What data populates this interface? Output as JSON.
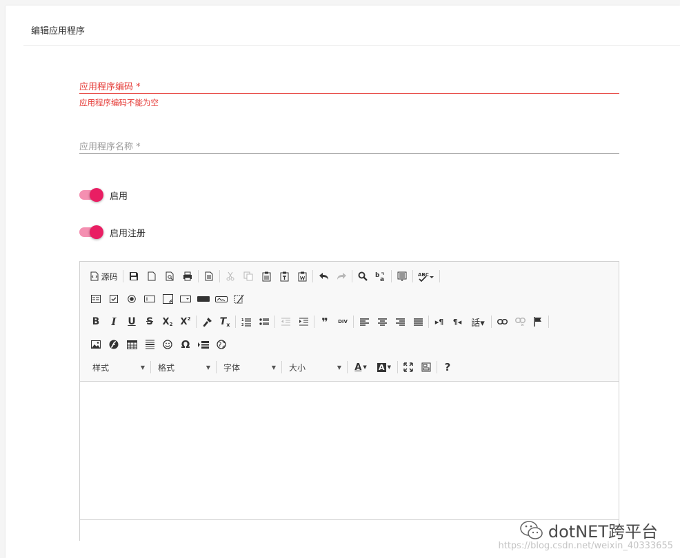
{
  "panel": {
    "title": "编辑应用程序"
  },
  "form": {
    "code": {
      "label": "应用程序编码 *",
      "error": "应用程序编码不能为空"
    },
    "name": {
      "label": "应用程序名称 *"
    },
    "enabled": {
      "label": "启用",
      "on": true
    },
    "register": {
      "label": "启用注册",
      "on": true
    }
  },
  "editor": {
    "row1": {
      "source": "源码",
      "buttons": [
        "save-icon",
        "new-page-icon",
        "preview-icon",
        "print-icon",
        "templates-icon",
        "cut-icon",
        "copy-icon",
        "paste-icon",
        "paste-text-icon",
        "paste-word-icon",
        "undo-icon",
        "redo-icon",
        "find-icon",
        "replace-icon",
        "select-all-icon",
        "spellcheck-icon"
      ]
    },
    "row2": {
      "buttons": [
        "form-icon",
        "checkbox-icon",
        "radio-icon",
        "textfield-icon",
        "textarea-icon",
        "select-icon",
        "button-icon",
        "imagebutton-icon",
        "hiddenfield-icon"
      ]
    },
    "row3": {
      "bold": "B",
      "italic": "I",
      "underline": "U",
      "strike": "S",
      "subscript": "X",
      "superscript": "X",
      "clear_format": "T",
      "blockquote": "❞",
      "div": "DIV"
    },
    "row4": {
      "special_char": "Ω"
    },
    "row5": {
      "styles": "样式",
      "format": "格式",
      "font": "字体",
      "size": "大小",
      "text_color": "A",
      "bg_color": "A",
      "help": "?"
    }
  },
  "watermark": {
    "brand": "dotNET跨平台",
    "url": "https://blog.csdn.net/weixin_40333655"
  },
  "colors": {
    "error": "#e53935",
    "accent": "#e91e63",
    "accent_light": "#f48fb1"
  }
}
